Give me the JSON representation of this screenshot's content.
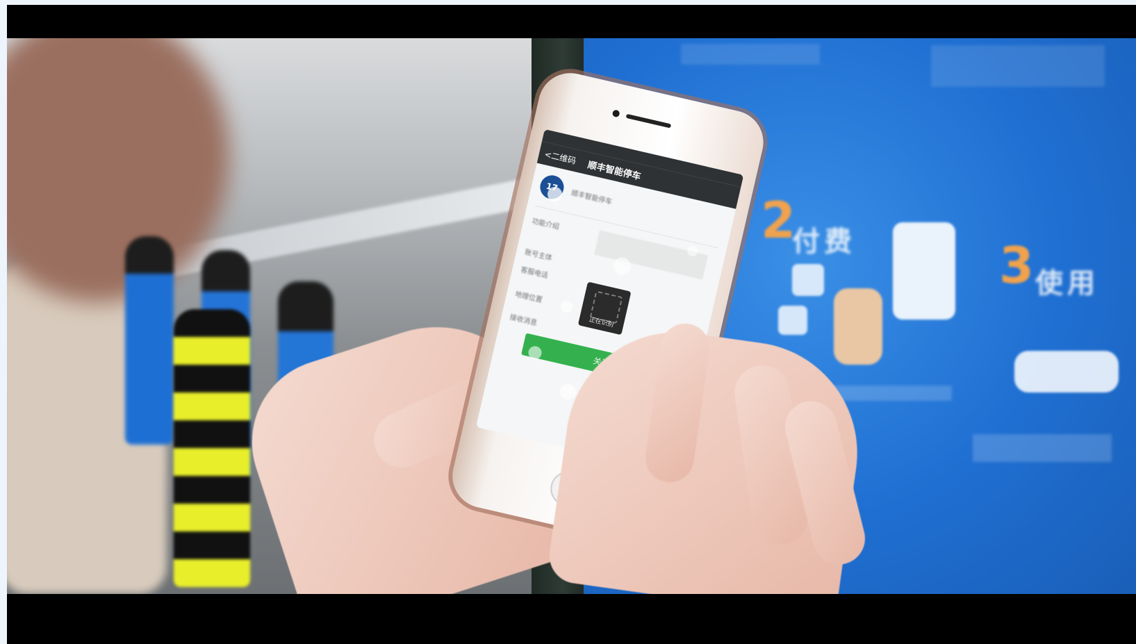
{
  "phone": {
    "nav": {
      "back_label": "<二维码",
      "title": "顺丰智能停车"
    },
    "profile": {
      "name": "顺丰智能停车",
      "avatar_text": "17"
    },
    "rows": [
      {
        "label": "功能介绍"
      },
      {
        "label": "账号主体"
      },
      {
        "label": "客服电话"
      },
      {
        "label": "地理位置"
      },
      {
        "label": "接收消息"
      }
    ],
    "qr_caption": "正在识别",
    "follow_button": "关注"
  },
  "panel": {
    "step2_number": "2",
    "step2_label": "付费",
    "step3_number": "3",
    "step3_label": "使用"
  },
  "colors": {
    "panel_blue": "#1f6fd2",
    "follow_green": "#34b14e",
    "letterbox": "#000000"
  }
}
